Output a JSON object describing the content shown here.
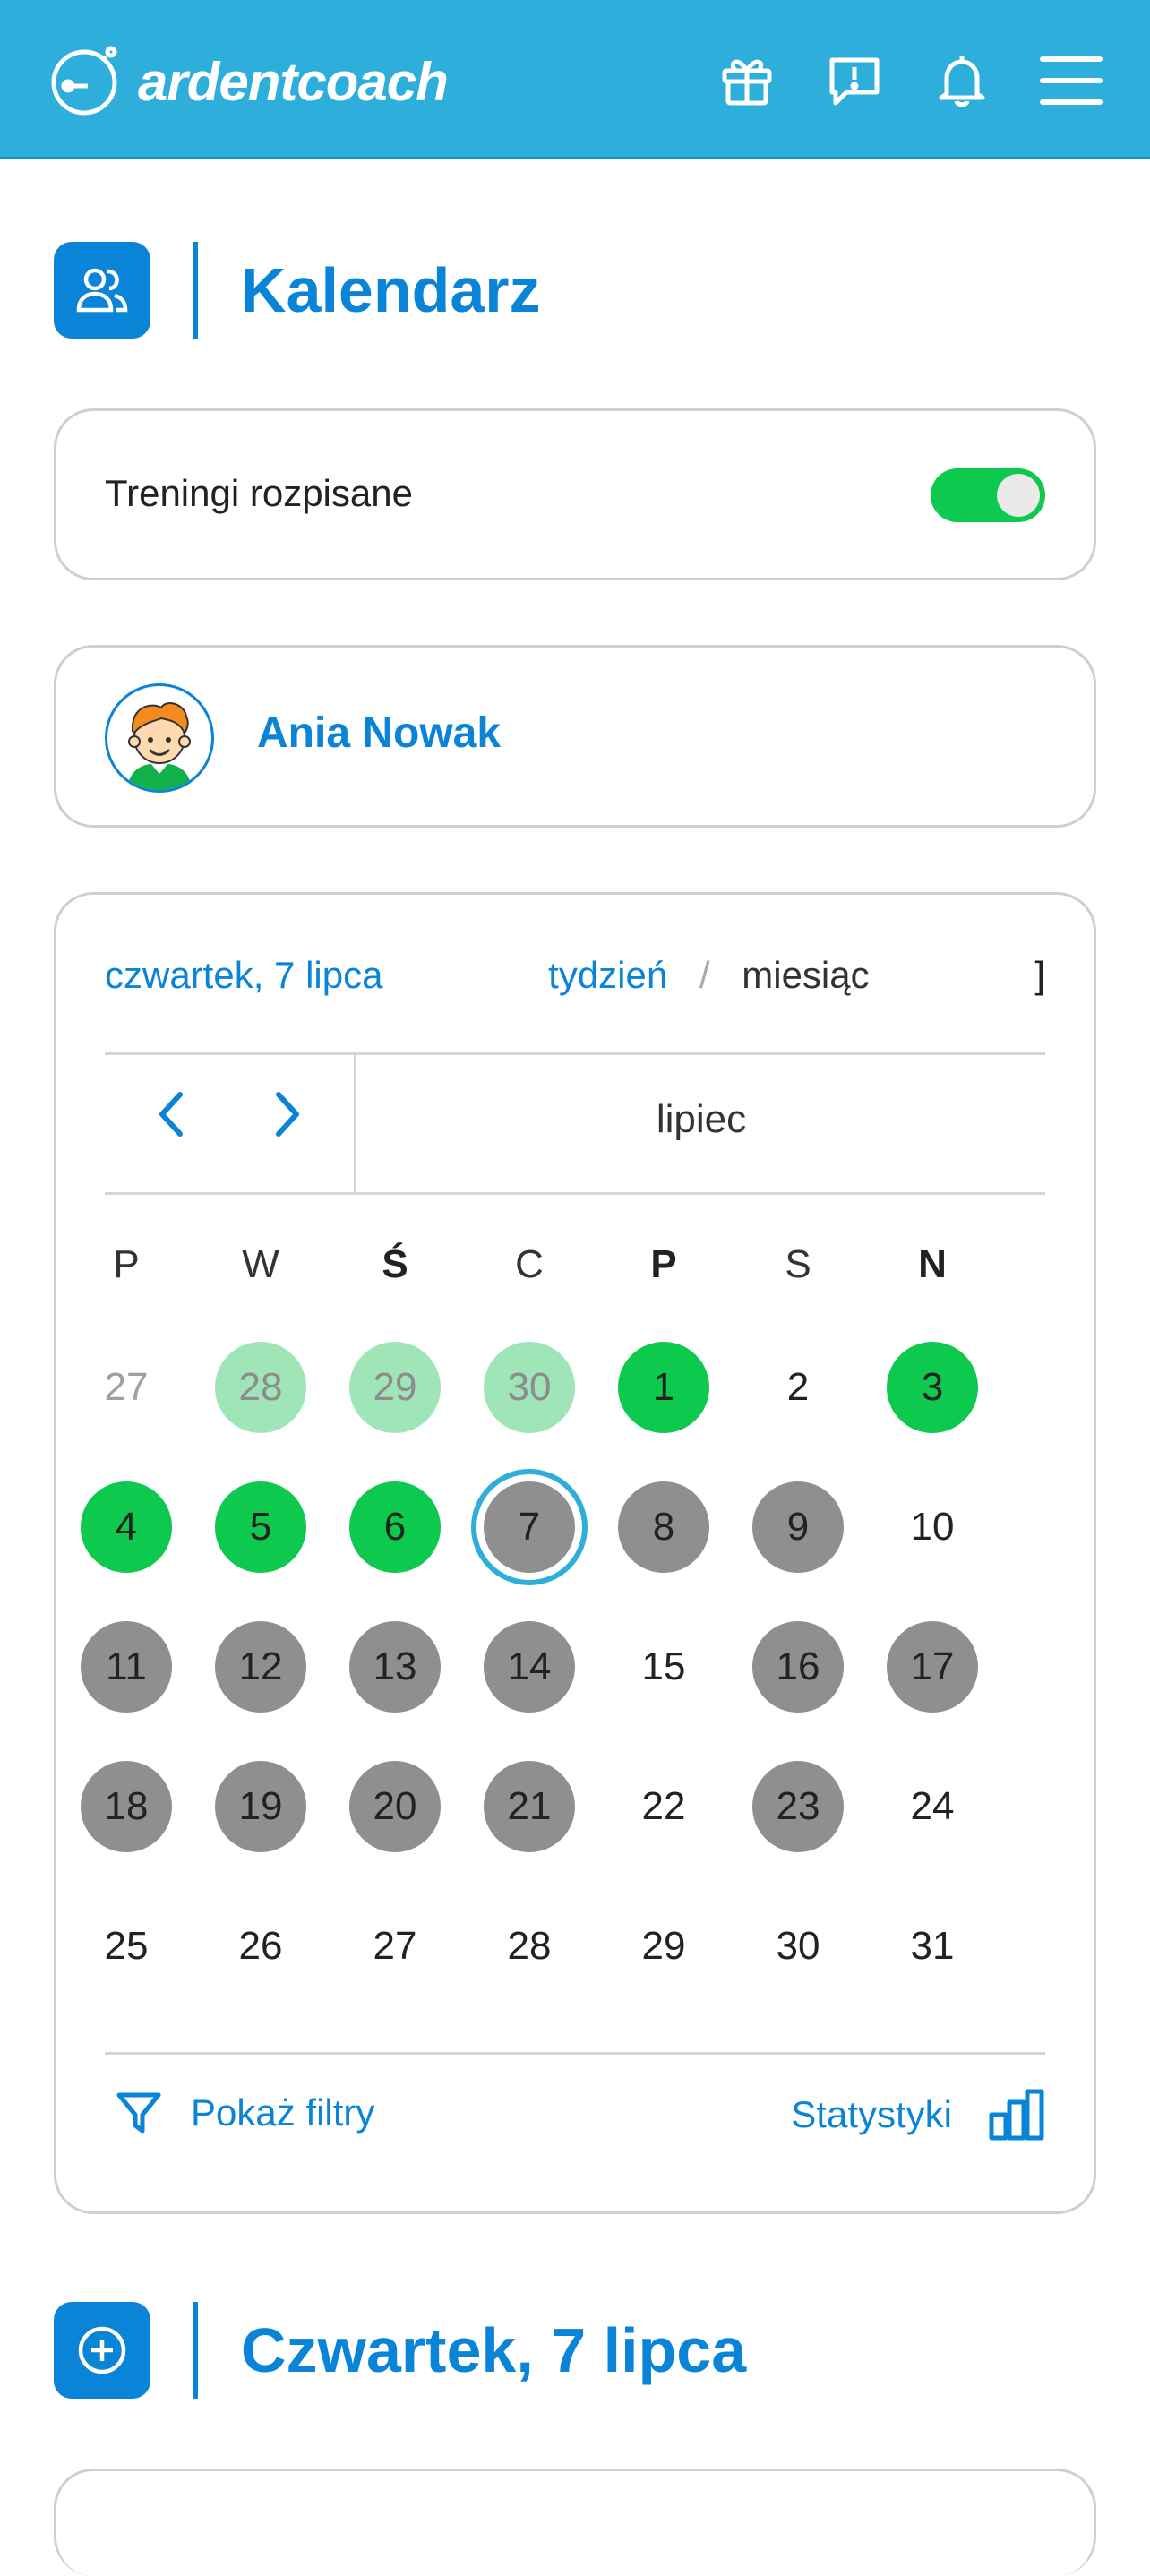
{
  "header": {
    "brand": "ardentcoach",
    "colors": {
      "bar": "#2daedb",
      "accent": "#0a84d6",
      "green": "#0dc94d",
      "gray": "#8f8f8f"
    },
    "icons": [
      "gift-icon",
      "feedback-icon",
      "bell-icon",
      "menu-icon"
    ]
  },
  "calendar_section": {
    "title": "Kalendarz",
    "icon": "users-icon"
  },
  "filter_toggle": {
    "label": "Treningi rozpisane",
    "on": true
  },
  "athlete": {
    "name": "Ania Nowak",
    "avatar": "avatar-boy-icon"
  },
  "calendar": {
    "selected_date": "czwartek, 7 lipca",
    "view_week": "tydzień",
    "view_separator": "/",
    "view_month": "miesiąc",
    "month": "lipiec",
    "weekdays": [
      "P",
      "W",
      "Ś",
      "C",
      "P",
      "S",
      "N"
    ],
    "weeks": [
      [
        {
          "d": "27",
          "s": "faded"
        },
        {
          "d": "28",
          "s": "lightgreen"
        },
        {
          "d": "29",
          "s": "lightgreen"
        },
        {
          "d": "30",
          "s": "lightgreen"
        },
        {
          "d": "1",
          "s": "green"
        },
        {
          "d": "2",
          "s": "plain"
        },
        {
          "d": "3",
          "s": "green"
        }
      ],
      [
        {
          "d": "4",
          "s": "green"
        },
        {
          "d": "5",
          "s": "green"
        },
        {
          "d": "6",
          "s": "green"
        },
        {
          "d": "7",
          "s": "today"
        },
        {
          "d": "8",
          "s": "gray"
        },
        {
          "d": "9",
          "s": "gray"
        },
        {
          "d": "10",
          "s": "plain"
        }
      ],
      [
        {
          "d": "11",
          "s": "gray"
        },
        {
          "d": "12",
          "s": "gray"
        },
        {
          "d": "13",
          "s": "gray"
        },
        {
          "d": "14",
          "s": "gray"
        },
        {
          "d": "15",
          "s": "plain"
        },
        {
          "d": "16",
          "s": "gray"
        },
        {
          "d": "17",
          "s": "gray"
        }
      ],
      [
        {
          "d": "18",
          "s": "gray"
        },
        {
          "d": "19",
          "s": "gray"
        },
        {
          "d": "20",
          "s": "gray"
        },
        {
          "d": "21",
          "s": "gray"
        },
        {
          "d": "22",
          "s": "plain"
        },
        {
          "d": "23",
          "s": "gray"
        },
        {
          "d": "24",
          "s": "plain"
        }
      ],
      [
        {
          "d": "25",
          "s": "plain"
        },
        {
          "d": "26",
          "s": "plain"
        },
        {
          "d": "27",
          "s": "plain"
        },
        {
          "d": "28",
          "s": "plain"
        },
        {
          "d": "29",
          "s": "plain"
        },
        {
          "d": "30",
          "s": "plain"
        },
        {
          "d": "31",
          "s": "plain"
        }
      ]
    ],
    "show_filters": "Pokaż filtry",
    "statistics": "Statystyki"
  },
  "day_section": {
    "title": "Czwartek, 7 lipca",
    "icon": "add-circle-icon"
  }
}
